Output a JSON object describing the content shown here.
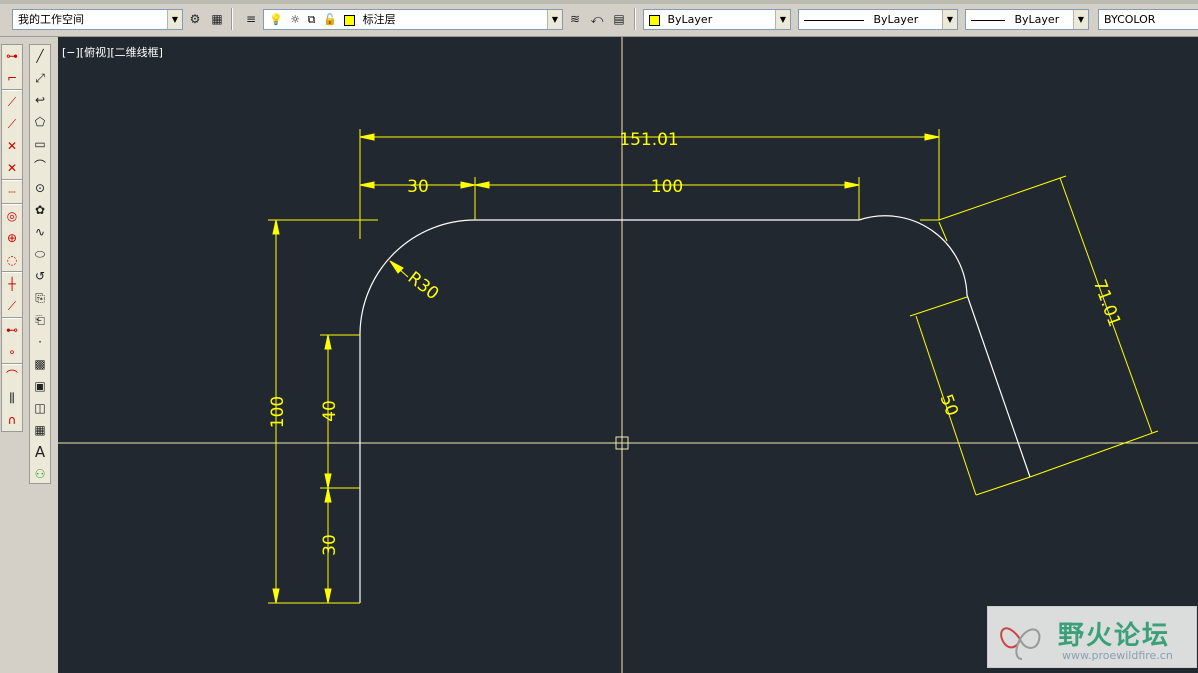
{
  "toolbar": {
    "workspace_value": "我的工作空间",
    "layer_value": "标注层",
    "color_value": "ByLayer",
    "linetype_value": "ByLayer",
    "lineweight_value": "ByLayer",
    "plotstyle_value": "BYCOLOR",
    "colors": {
      "layer_swatch": "#ffff00"
    }
  },
  "viewport": {
    "label": "[−][俯视][二维线框]"
  },
  "drawing": {
    "dims": {
      "overall_width": "151.01",
      "arc_span": "30",
      "flat_span": "100",
      "total_height": "100",
      "upper_height": "40",
      "lower_height": "30",
      "radius": "R30",
      "slant_length": "71.01",
      "slant_offset": "50"
    },
    "colors": {
      "geometry": "#ffffff",
      "dimension": "#ffff00",
      "crosshair": "#f5e7b0",
      "background": "#212830"
    }
  },
  "watermark": {
    "title": "野火论坛",
    "url": "www.proewildfire.cn"
  }
}
